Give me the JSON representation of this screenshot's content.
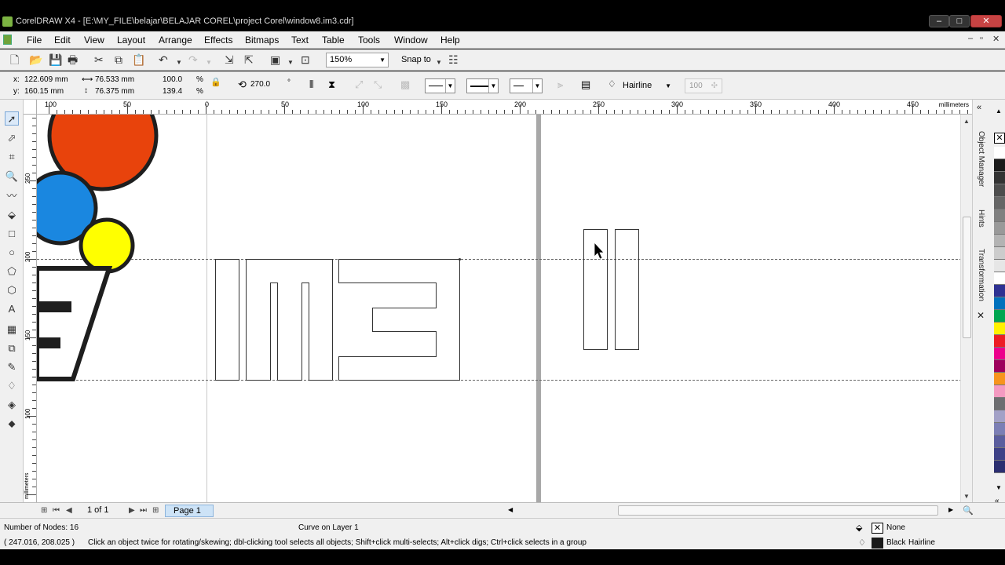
{
  "window": {
    "title": "CorelDRAW X4 - [E:\\MY_FILE\\belajar\\BELAJAR COREL\\project Corel\\window8.im3.cdr]"
  },
  "menu": [
    "File",
    "Edit",
    "View",
    "Layout",
    "Arrange",
    "Effects",
    "Bitmaps",
    "Text",
    "Table",
    "Tools",
    "Window",
    "Help"
  ],
  "toolbar": {
    "zoom": "150%",
    "snap_to": "Snap to"
  },
  "props": {
    "x_label": "x:",
    "x": "122.609 mm",
    "y_label": "y:",
    "y": "160.15 mm",
    "w": "76.533 mm",
    "h": "76.375 mm",
    "sx": "100.0",
    "sy": "139.4",
    "pct": "%",
    "rotation": "270.0",
    "deg": "°",
    "outline": "Hairline",
    "opacity": "100"
  },
  "ruler": {
    "unit": "millimeters",
    "h_labels": [
      "100",
      "50",
      "0",
      "50",
      "100",
      "150",
      "200",
      "250",
      "300",
      "350",
      "400",
      "450"
    ],
    "v_labels": [
      "250",
      "200",
      "150",
      "100"
    ],
    "v_unit": "millimeters"
  },
  "dockers": [
    "Object Manager",
    "Hints",
    "Transformation"
  ],
  "palette": [
    "#ffffff",
    "#1a1a1a",
    "#333333",
    "#4d4d4d",
    "#666666",
    "#808080",
    "#999999",
    "#b3b3b3",
    "#cccccc",
    "#e6e6e6",
    "#ffffff",
    "#2e3192",
    "#0071bc",
    "#00a651",
    "#fff200",
    "#ed1c24",
    "#ec008c",
    "#9e005d",
    "#f7941d",
    "#f49ac1",
    "#6d6e71",
    "#a3a1c7",
    "#7c7fb5",
    "#5b5e9e",
    "#3e4187",
    "#2b2e70"
  ],
  "pages": {
    "count": "1 of 1",
    "tab": "Page 1"
  },
  "status": {
    "nodes": "Number of Nodes: 16",
    "layer": "Curve on Layer 1",
    "coords": "( 247.016, 208.025 )",
    "hint": "Click an object twice for rotating/skewing; dbl-clicking tool selects all objects; Shift+click multi-selects; Alt+click digs; Ctrl+click selects in a group",
    "fill": "None",
    "outline_color": "Black",
    "outline_width": "Hairline"
  },
  "colors": {
    "orange": "#e8430c",
    "blue": "#1a87e0",
    "yellow": "#ffff00",
    "dark": "#1e1e1e"
  }
}
